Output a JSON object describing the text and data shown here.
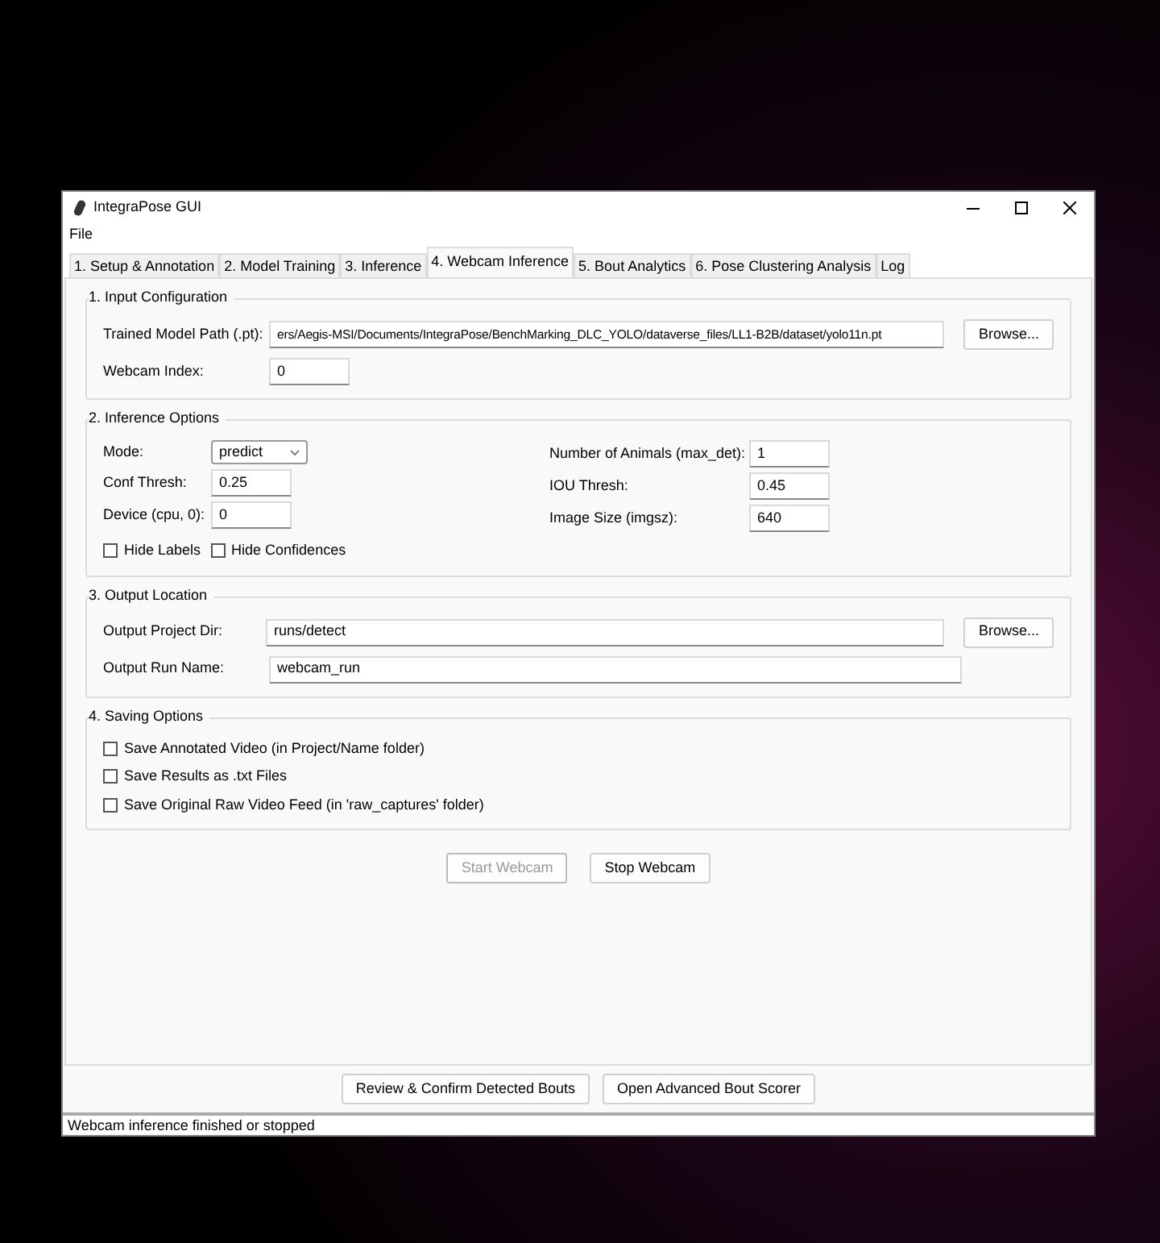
{
  "window": {
    "title": "IntegraPose GUI"
  },
  "menu": [
    "File"
  ],
  "tabs": [
    {
      "label": "1. Setup & Annotation",
      "selected": false
    },
    {
      "label": "2. Model Training",
      "selected": false
    },
    {
      "label": "3. Inference",
      "selected": false
    },
    {
      "label": "4. Webcam Inference",
      "selected": true
    },
    {
      "label": "5. Bout Analytics",
      "selected": false
    },
    {
      "label": "6. Pose Clustering Analysis",
      "selected": false
    },
    {
      "label": "Log",
      "selected": false
    }
  ],
  "sections": [
    {
      "kind": "fields",
      "title": "1. Input Configuration",
      "rows": [
        {
          "label": "Trained Model Path (.pt):",
          "value": "ers/Aegis-MSI/Documents/IntegraPose/BenchMarking_DLC_YOLO/dataverse_files/LL1-B2B/dataset/yolo11n.pt",
          "kind": "long",
          "button": "Browse..."
        },
        {
          "label": "Webcam Index:",
          "value": "0",
          "kind": "short"
        }
      ]
    },
    {
      "kind": "options",
      "title": "2. Inference Options",
      "left": [
        {
          "kind": "dropdown",
          "label": "Mode:",
          "value": "predict"
        },
        {
          "kind": "entry",
          "label": "Conf Thresh:",
          "value": "0.25"
        },
        {
          "kind": "entry",
          "label": "Device (cpu, 0):",
          "value": "0"
        }
      ],
      "right": [
        {
          "kind": "entry",
          "label": "Number of Animals (max_det):",
          "value": "1"
        },
        {
          "kind": "entry",
          "label": "IOU Thresh:",
          "value": "0.45"
        },
        {
          "kind": "entry",
          "label": "Image Size (imgsz):",
          "value": "640"
        }
      ],
      "checks": [
        {
          "label": "Hide Labels",
          "checked": false
        },
        {
          "label": "Hide Confidences",
          "checked": false
        }
      ]
    },
    {
      "kind": "fields",
      "title": "3. Output Location",
      "rows": [
        {
          "label": "Output Project Dir:",
          "value": "runs/detect",
          "kind": "long",
          "button": "Browse..."
        },
        {
          "label": "Output Run Name:",
          "value": "webcam_run",
          "kind": "long"
        }
      ]
    },
    {
      "kind": "checks",
      "title": "4. Saving Options",
      "checks": [
        {
          "label": "Save Annotated Video (in Project/Name folder)",
          "checked": false
        },
        {
          "label": "Save Results as .txt Files",
          "checked": false
        },
        {
          "label": "Save Original Raw Video Feed (in 'raw_captures' folder)",
          "checked": false
        }
      ]
    }
  ],
  "actions": [
    {
      "label": "Start Webcam",
      "disabled": true
    },
    {
      "label": "Stop Webcam",
      "disabled": false
    }
  ],
  "footer_buttons": [
    "Review & Confirm Detected Bouts",
    "Open Advanced Bout Scorer"
  ],
  "status_bar": "Webcam inference finished or stopped"
}
